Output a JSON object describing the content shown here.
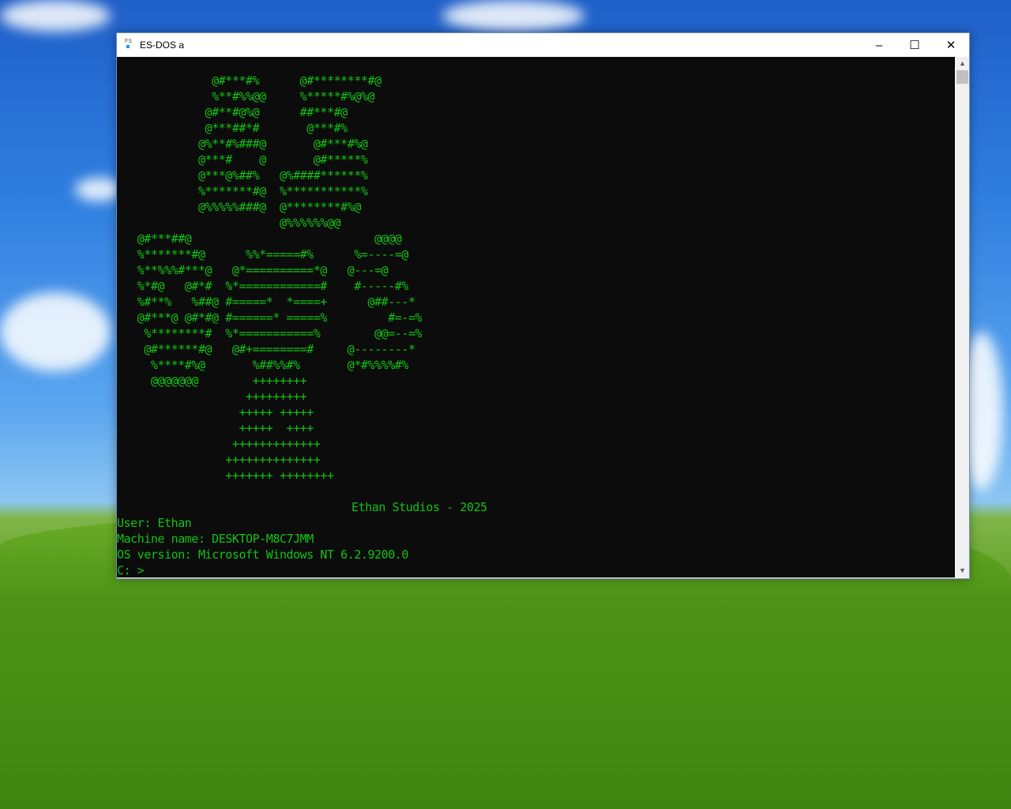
{
  "window": {
    "title": "ES-DOS a",
    "minimize": "–",
    "maximize": "☐",
    "close": "✕"
  },
  "terminal": {
    "art": [
      "              @#***#%      @#********#@",
      "              %**#%%@@     %*****#%@%@",
      "             @#**#@%@      ##***#@",
      "             @***##*#       @***#%",
      "            @%**#%###@       @#***#%@",
      "            @***#    @       @#*****%",
      "            @***@%##%   @%####******%",
      "            %*******#@  %***********%",
      "            @%%%%%###@  @********#%@",
      "                        @%%%%%%@@",
      "   @#***##@                           @@@@",
      "   %*******#@      %%*=====#%      %=----=@",
      "   %**%%%#***@   @*==========*@   @---=@",
      "   %*#@   @#*#  %*============#    #-----#%",
      "   %#**%   %##@ #=====*  *====+      @##---*",
      "   @#***@ @#*#@ #======* =====%         #=-=%",
      "    %********#  %*===========%        @@=--=%",
      "    @#******#@   @#+========#     @--------*",
      "     %****#%@       %##%%#%       @*#%%%%#%",
      "     @@@@@@@        ++++++++",
      "                   +++++++++",
      "                  +++++ +++++",
      "                  +++++  ++++",
      "                 +++++++++++++",
      "                ++++++++++++++",
      "                +++++++ ++++++++"
    ],
    "credit": "Ethan Studios - 2025",
    "user": "User: Ethan",
    "machine": "Machine name: DESKTOP-M8C7JMM",
    "os": "OS version: Microsoft Windows NT 6.2.9200.0",
    "prompt": "C: >"
  },
  "colors": {
    "text": "#13c313",
    "bg": "#0c0c0c"
  }
}
